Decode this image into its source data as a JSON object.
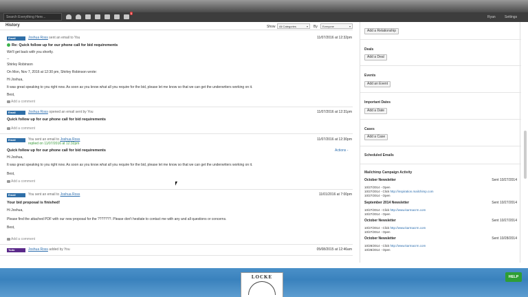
{
  "topbar": {
    "search_placeholder": "Search Everything Here...",
    "notification_count": "5",
    "user": "Ryan",
    "settings": "Settings",
    "icons": [
      "person-icon",
      "people-icon",
      "building-icon",
      "inbox-icon",
      "calendar-icon",
      "mail-icon",
      "notifications-icon"
    ]
  },
  "history": {
    "title": "History",
    "show_label": "Show",
    "category_value": "All Categories",
    "by_label": "By",
    "by_value": "Everyone"
  },
  "entries": [
    {
      "tag": "Email",
      "meta_user": "Joshua Ross",
      "meta_text": " sent an email to You",
      "date": "11/07/2016 at 12:32pm",
      "subject": "Re: Quick follow up for our phone call for bid requirements",
      "lines": [
        "We'll get back with you shortly.",
        "--",
        "Shirley Robinson",
        "On Mon, Nov 7, 2016 at 12:30 pm, Shirley Robinson wrote:",
        "Hi Joshua,",
        "It was great speaking to you right now. As soon as you know what all you require for the bid, please let me know so that we can get the underwriters working on it.",
        "Best,"
      ],
      "add_comment": "Add a comment"
    },
    {
      "tag": "Email",
      "meta_user": "Joshua Ross",
      "meta_text": " opened an email sent by You",
      "date": "11/07/2016 at 12:31pm",
      "subject": "Quick follow up for our phone call for bid requirements",
      "add_comment": "Add a comment"
    },
    {
      "tag": "Email",
      "meta_prefix": "You sent an email to ",
      "meta_user": "Joshua Ross",
      "meta_replied": "replied on 11/07/2016 at 12:32pm",
      "date": "11/07/2016 at 12:30pm",
      "actions": "Actions -",
      "subject": "Quick follow up for our phone call for bid requirements",
      "lines": [
        "Hi Joshua,",
        "It was great speaking to you right now. As soon as you know what all you require for the bid, please let me know so that we can get the underwriters working on it.",
        "Best,"
      ],
      "add_comment": "Add a comment"
    },
    {
      "tag": "Email",
      "meta_prefix": "You sent an email to ",
      "meta_user": "Joshua Ross",
      "date": "11/01/2016 at 7:00pm",
      "subject": "Your bid proposal is finished!",
      "lines": [
        "Hi Joshua,",
        "Please find the attached PDF with our new proposal for the ???????. Please don't hesitate to contact me with any and all questions or concerns.",
        "Best,"
      ],
      "add_comment": "Add a comment"
    },
    {
      "tag": "Todo",
      "meta_user": "Joshua Ross",
      "meta_text": " added by You",
      "date": "05/08/2015 at 12:46am"
    }
  ],
  "sidebar": {
    "add_relationship": "Add a Relationship",
    "deals_title": "Deals",
    "add_deal": "Add a Deal",
    "events_title": "Events",
    "add_event": "Add an Event",
    "dates_title": "Important Dates",
    "add_date": "Add a Date",
    "cases_title": "Cases",
    "add_case": "Add a Case",
    "scheduled_title": "Scheduled Emails",
    "mailchimp_title": "Mailchimp Campaign Activity",
    "campaigns": [
      {
        "name": "October Newsletter",
        "sent": "Sent 10/27/2014",
        "activity": [
          {
            "text": "10/27/2014 - Open",
            "link": ""
          },
          {
            "text": "10/27/2014 - Click ",
            "link": "http://inspiration.mailchimp.com"
          },
          {
            "text": "10/27/2014 - Open",
            "link": ""
          }
        ]
      },
      {
        "name": "September 2014 Newsletter",
        "sent": "Sent 10/27/2014",
        "activity": [
          {
            "text": "10/27/2014 - Click ",
            "link": "http://www.karmacrm.com"
          },
          {
            "text": "10/27/2014 - Open",
            "link": ""
          }
        ]
      },
      {
        "name": "October Newsletter",
        "sent": "Sent 10/27/2014",
        "activity": [
          {
            "text": "10/27/2014 - Click ",
            "link": "http://www.karmacrm.com"
          },
          {
            "text": "10/27/2014 - Open",
            "link": ""
          }
        ]
      },
      {
        "name": "October Newsletter",
        "sent": "Sent 10/28/2014",
        "activity": [
          {
            "text": "10/28/2014 - Click ",
            "link": "http://www.karmacrm.com"
          },
          {
            "text": "10/28/2014 - Open",
            "link": ""
          }
        ]
      }
    ]
  },
  "footer": {
    "logo_text": "LOCKE",
    "help": "HELP"
  }
}
